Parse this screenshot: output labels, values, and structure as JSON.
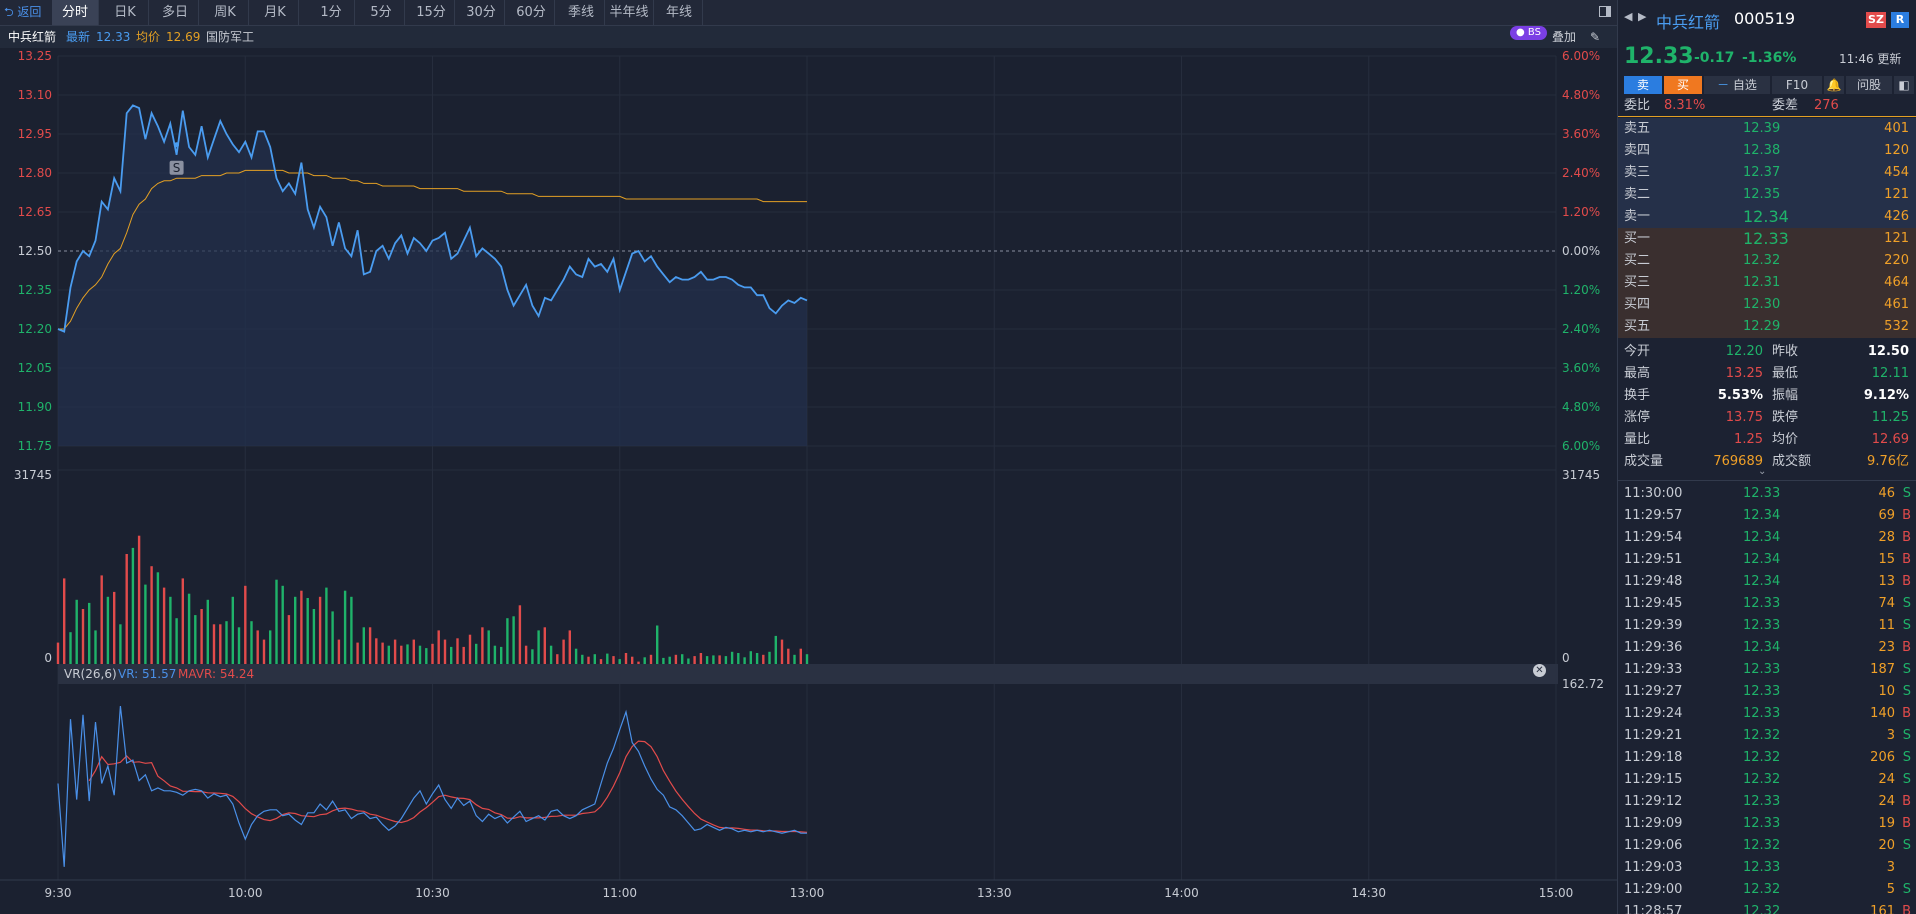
{
  "toolbar": {
    "back_label": "⮌ 返回",
    "tabs": [
      "分时",
      "日K",
      "多日",
      "周K",
      "月K",
      "1分",
      "5分",
      "15分",
      "30分",
      "60分",
      "季线",
      "半年线",
      "年线"
    ],
    "active_tab": "分时"
  },
  "stock": {
    "name": "中兵红箭",
    "code": "000519",
    "price": "12.33",
    "change": "-0.17",
    "change_pct": "-1.36%",
    "update_time": "11:46 更新",
    "exchange": "SZ",
    "flag": "R"
  },
  "infobar": {
    "name": "中兵红箭",
    "latest_label": "最新",
    "latest": "12.33",
    "avg_label": "均价",
    "avg": "12.69",
    "sector": "国防军工",
    "badge": "BS",
    "overlay": "叠加"
  },
  "price_axis": {
    "left": [
      "13.25",
      "13.10",
      "12.95",
      "12.80",
      "12.65",
      "12.50",
      "12.35",
      "12.20",
      "12.05",
      "11.90",
      "11.75"
    ],
    "right": [
      "6.00%",
      "4.80%",
      "3.60%",
      "2.40%",
      "1.20%",
      "0.00%",
      "1.20%",
      "2.40%",
      "3.60%",
      "4.80%",
      "6.00%"
    ]
  },
  "volume_axis": {
    "max_left": "31745",
    "zero_left": "0",
    "max_right": "31745",
    "zero_right": "0"
  },
  "vr": {
    "label": "VR(26,6)",
    "vr_text": "VR: 51.57",
    "mavr_text": "MAVR: 54.24",
    "axis_top": "162.72"
  },
  "time_axis": [
    "9:30",
    "10:00",
    "10:30",
    "11:00",
    "13:00",
    "13:30",
    "14:00",
    "14:30",
    "15:00"
  ],
  "marker_label": "S",
  "chart_data": {
    "type": "line",
    "prev_close": 12.5,
    "ylim": [
      11.75,
      13.25
    ],
    "minutes": 121,
    "price": [
      12.2,
      12.19,
      12.36,
      12.46,
      12.5,
      12.48,
      12.54,
      12.69,
      12.66,
      12.78,
      12.73,
      13.03,
      13.06,
      13.05,
      12.93,
      13.03,
      12.98,
      12.92,
      12.99,
      12.87,
      13.04,
      12.9,
      12.87,
      12.98,
      12.86,
      12.93,
      13.0,
      12.95,
      12.91,
      12.88,
      12.92,
      12.86,
      12.96,
      12.96,
      12.9,
      12.78,
      12.73,
      12.76,
      12.72,
      12.84,
      12.66,
      12.59,
      12.67,
      12.63,
      12.52,
      12.61,
      12.51,
      12.48,
      12.58,
      12.41,
      12.42,
      12.5,
      12.52,
      12.47,
      12.53,
      12.56,
      12.49,
      12.55,
      12.53,
      12.5,
      12.54,
      12.55,
      12.57,
      12.47,
      12.49,
      12.54,
      12.59,
      12.48,
      12.51,
      12.49,
      12.47,
      12.44,
      12.35,
      12.29,
      12.33,
      12.37,
      12.29,
      12.25,
      12.32,
      12.31,
      12.35,
      12.39,
      12.44,
      12.41,
      12.4,
      12.47,
      12.44,
      12.45,
      12.42,
      12.47,
      12.35,
      12.42,
      12.49,
      12.5,
      12.46,
      12.48,
      12.44,
      12.41,
      12.38,
      12.4,
      12.39,
      12.39,
      12.4,
      12.42,
      12.39,
      12.39,
      12.4,
      12.4,
      12.39,
      12.37,
      12.36,
      12.36,
      12.33,
      12.33,
      12.28,
      12.26,
      12.29,
      12.31,
      12.3,
      12.32,
      12.31
    ],
    "avg": [
      12.2,
      12.2,
      12.23,
      12.28,
      12.32,
      12.35,
      12.37,
      12.4,
      12.45,
      12.49,
      12.51,
      12.57,
      12.64,
      12.68,
      12.7,
      12.74,
      12.76,
      12.77,
      12.77,
      12.78,
      12.78,
      12.78,
      12.78,
      12.79,
      12.79,
      12.79,
      12.79,
      12.8,
      12.8,
      12.8,
      12.81,
      12.81,
      12.81,
      12.81,
      12.81,
      12.81,
      12.81,
      12.8,
      12.8,
      12.8,
      12.8,
      12.79,
      12.79,
      12.79,
      12.78,
      12.78,
      12.78,
      12.77,
      12.77,
      12.76,
      12.76,
      12.76,
      12.75,
      12.75,
      12.75,
      12.75,
      12.75,
      12.75,
      12.74,
      12.74,
      12.74,
      12.74,
      12.74,
      12.74,
      12.74,
      12.73,
      12.73,
      12.73,
      12.73,
      12.73,
      12.73,
      12.73,
      12.72,
      12.72,
      12.72,
      12.72,
      12.72,
      12.71,
      12.71,
      12.71,
      12.71,
      12.71,
      12.71,
      12.71,
      12.71,
      12.71,
      12.71,
      12.71,
      12.71,
      12.71,
      12.71,
      12.7,
      12.7,
      12.7,
      12.7,
      12.7,
      12.7,
      12.7,
      12.7,
      12.7,
      12.7,
      12.7,
      12.7,
      12.7,
      12.7,
      12.7,
      12.7,
      12.7,
      12.7,
      12.7,
      12.7,
      12.7,
      12.7,
      12.69,
      12.69,
      12.69,
      12.69,
      12.69,
      12.69,
      12.69,
      12.69
    ],
    "volume": [
      3500,
      14000,
      5200,
      10500,
      9000,
      10000,
      5500,
      14500,
      11000,
      11800,
      6500,
      18000,
      19000,
      21000,
      13000,
      16000,
      15000,
      12500,
      11000,
      7500,
      14000,
      11500,
      8000,
      9000,
      10500,
      6500,
      6500,
      7000,
      11000,
      6000,
      12800,
      7000,
      5500,
      4000,
      5500,
      13800,
      12800,
      8000,
      11000,
      12000,
      10800,
      9000,
      11000,
      12500,
      8600,
      4000,
      12000,
      11000,
      3500,
      6000,
      6000,
      4200,
      3500,
      3000,
      4000,
      3000,
      3200,
      4000,
      3000,
      2600,
      3300,
      5500,
      4000,
      2800,
      4200,
      2800,
      4800,
      3300,
      6000,
      5500,
      3000,
      2800,
      7500,
      7800,
      9600,
      3000,
      2400,
      5500,
      6000,
      3000,
      1600,
      4000,
      5500,
      2500,
      1500,
      1200,
      1600,
      800,
      1700,
      1300,
      800,
      1800,
      1200,
      400,
      1100,
      1500,
      6300,
      1000,
      1200,
      1500,
      1600,
      900,
      1300,
      1800,
      1300,
      1400,
      1400,
      1300,
      2000,
      1800,
      1100,
      2100,
      1800,
      1500,
      2000,
      4600,
      4000,
      2500,
      1500,
      2500,
      1600
    ],
    "volume_dir": [
      1,
      1,
      0,
      0,
      1,
      0,
      0,
      1,
      0,
      1,
      0,
      1,
      0,
      1,
      0,
      1,
      0,
      1,
      0,
      0,
      1,
      0,
      0,
      1,
      0,
      1,
      1,
      0,
      0,
      0,
      1,
      0,
      1,
      1,
      0,
      0,
      0,
      1,
      0,
      1,
      0,
      0,
      1,
      0,
      0,
      1,
      0,
      0,
      1,
      0,
      1,
      1,
      1,
      0,
      1,
      1,
      0,
      1,
      0,
      0,
      1,
      1,
      1,
      0,
      1,
      1,
      1,
      0,
      1,
      0,
      0,
      0,
      0,
      0,
      1,
      1,
      0,
      0,
      1,
      0,
      1,
      1,
      1,
      0,
      0,
      1,
      0,
      1,
      0,
      1,
      0,
      1,
      1,
      1,
      0,
      1,
      0,
      0,
      0,
      1,
      0,
      0,
      1,
      1,
      0,
      0,
      1,
      0,
      0,
      0,
      0,
      0,
      0,
      1,
      0,
      0,
      1,
      1,
      0,
      1,
      0
    ],
    "vr_series": [
      96,
      39,
      140,
      85,
      143,
      84,
      138,
      96,
      108,
      88,
      149,
      110,
      112,
      98,
      102,
      91,
      93,
      91,
      91,
      90,
      88,
      91,
      92,
      91,
      86,
      89,
      87,
      88,
      82,
      69,
      58,
      68,
      74,
      77,
      78,
      78,
      74,
      75,
      71,
      68,
      76,
      76,
      82,
      78,
      84,
      77,
      78,
      72,
      75,
      76,
      72,
      73,
      68,
      64,
      67,
      72,
      79,
      86,
      91,
      82,
      89,
      95,
      85,
      79,
      86,
      81,
      84,
      74,
      70,
      75,
      72,
      74,
      69,
      73,
      77,
      70,
      72,
      74,
      71,
      77,
      78,
      74,
      72,
      74,
      78,
      80,
      82,
      96,
      110,
      120,
      133,
      145,
      124,
      118,
      108,
      99,
      92,
      88,
      80,
      78,
      74,
      69,
      64,
      65,
      68,
      66,
      64,
      66,
      65,
      63,
      64,
      63,
      64,
      63,
      64,
      63,
      62,
      63,
      64,
      62,
      62
    ],
    "mavr_series": [
      null,
      null,
      null,
      null,
      null,
      null,
      null,
      null,
      null,
      null,
      null,
      null,
      null,
      null,
      null,
      null,
      null,
      null,
      null,
      null,
      null,
      null,
      null,
      null,
      null,
      null,
      null,
      null,
      null,
      null,
      null,
      null,
      null,
      null,
      null,
      null,
      null,
      null,
      null,
      null,
      null,
      null,
      null,
      null,
      null,
      null,
      null,
      null,
      null,
      null,
      null,
      null,
      null,
      null,
      null,
      null,
      null,
      null,
      null,
      null,
      null,
      null,
      null,
      null,
      null,
      null,
      null,
      null,
      null,
      null,
      null,
      null,
      null,
      null,
      null,
      null,
      null,
      null,
      null,
      null,
      null,
      null,
      null,
      null,
      null,
      null,
      null,
      null,
      null,
      null,
      null,
      null,
      null,
      null,
      null,
      null,
      null,
      null,
      null,
      null,
      null,
      null,
      null,
      null,
      null,
      null,
      null,
      null,
      null,
      null,
      null,
      null,
      null,
      null,
      null,
      null,
      null,
      null,
      null,
      null,
      null
    ],
    "vr_max": 162.72
  },
  "orderbook": {
    "ratio_label": "委比",
    "ratio": "8.31%",
    "diff_label": "委差",
    "diff": "276",
    "asks": [
      {
        "label": "卖五",
        "price": "12.39",
        "vol": "401"
      },
      {
        "label": "卖四",
        "price": "12.38",
        "vol": "120"
      },
      {
        "label": "卖三",
        "price": "12.37",
        "vol": "454"
      },
      {
        "label": "卖二",
        "price": "12.35",
        "vol": "121"
      },
      {
        "label": "卖一",
        "price": "12.34",
        "vol": "426"
      }
    ],
    "bids": [
      {
        "label": "买一",
        "price": "12.33",
        "vol": "121"
      },
      {
        "label": "买二",
        "price": "12.32",
        "vol": "220"
      },
      {
        "label": "买三",
        "price": "12.31",
        "vol": "464"
      },
      {
        "label": "买四",
        "price": "12.30",
        "vol": "461"
      },
      {
        "label": "买五",
        "price": "12.29",
        "vol": "532"
      }
    ]
  },
  "buttons": {
    "sell": "卖",
    "buy": "买",
    "watch": "自选",
    "f10": "F10",
    "ask": "问股"
  },
  "stats": [
    {
      "l1": "今开",
      "v1": "12.20",
      "c1": "green",
      "l2": "昨收",
      "v2": "12.50",
      "c2": "white"
    },
    {
      "l1": "最高",
      "v1": "13.25",
      "c1": "red",
      "l2": "最低",
      "v2": "12.11",
      "c2": "green"
    },
    {
      "l1": "换手",
      "v1": "5.53%",
      "c1": "white",
      "l2": "振幅",
      "v2": "9.12%",
      "c2": "white"
    },
    {
      "l1": "涨停",
      "v1": "13.75",
      "c1": "red",
      "l2": "跌停",
      "v2": "11.25",
      "c2": "green"
    },
    {
      "l1": "量比",
      "v1": "1.25",
      "c1": "red",
      "l2": "均价",
      "v2": "12.69",
      "c2": "red"
    },
    {
      "l1": "成交量",
      "v1": "769689",
      "c1": "orange",
      "l2": "成交额",
      "v2": "9.76亿",
      "c2": "orange"
    }
  ],
  "trades": [
    {
      "t": "11:30:00",
      "p": "12.33",
      "v": "46",
      "d": "S"
    },
    {
      "t": "11:29:57",
      "p": "12.34",
      "v": "69",
      "d": "B"
    },
    {
      "t": "11:29:54",
      "p": "12.34",
      "v": "28",
      "d": "B"
    },
    {
      "t": "11:29:51",
      "p": "12.34",
      "v": "15",
      "d": "B"
    },
    {
      "t": "11:29:48",
      "p": "12.34",
      "v": "13",
      "d": "B"
    },
    {
      "t": "11:29:45",
      "p": "12.33",
      "v": "74",
      "d": "S"
    },
    {
      "t": "11:29:39",
      "p": "12.33",
      "v": "11",
      "d": "S"
    },
    {
      "t": "11:29:36",
      "p": "12.34",
      "v": "23",
      "d": "B"
    },
    {
      "t": "11:29:33",
      "p": "12.33",
      "v": "187",
      "d": "S"
    },
    {
      "t": "11:29:27",
      "p": "12.33",
      "v": "10",
      "d": "S"
    },
    {
      "t": "11:29:24",
      "p": "12.33",
      "v": "140",
      "d": "B"
    },
    {
      "t": "11:29:21",
      "p": "12.32",
      "v": "3",
      "d": "S"
    },
    {
      "t": "11:29:18",
      "p": "12.32",
      "v": "206",
      "d": "S"
    },
    {
      "t": "11:29:15",
      "p": "12.32",
      "v": "24",
      "d": "S"
    },
    {
      "t": "11:29:12",
      "p": "12.33",
      "v": "24",
      "d": "B"
    },
    {
      "t": "11:29:09",
      "p": "12.33",
      "v": "19",
      "d": "B"
    },
    {
      "t": "11:29:06",
      "p": "12.32",
      "v": "20",
      "d": "S"
    },
    {
      "t": "11:29:03",
      "p": "12.33",
      "v": "3",
      "d": ""
    },
    {
      "t": "11:29:00",
      "p": "12.32",
      "v": "5",
      "d": "S"
    },
    {
      "t": "11:28:57",
      "p": "12.32",
      "v": "161",
      "d": "B"
    }
  ],
  "colors": {
    "up": "#e24b4b",
    "down": "#1fb36a",
    "price_line": "#4a9cf0",
    "avg_line": "#e3a024",
    "vr_line": "#4a90e8",
    "mavr_line": "#e24b4b",
    "accent": "#2b7de0"
  }
}
